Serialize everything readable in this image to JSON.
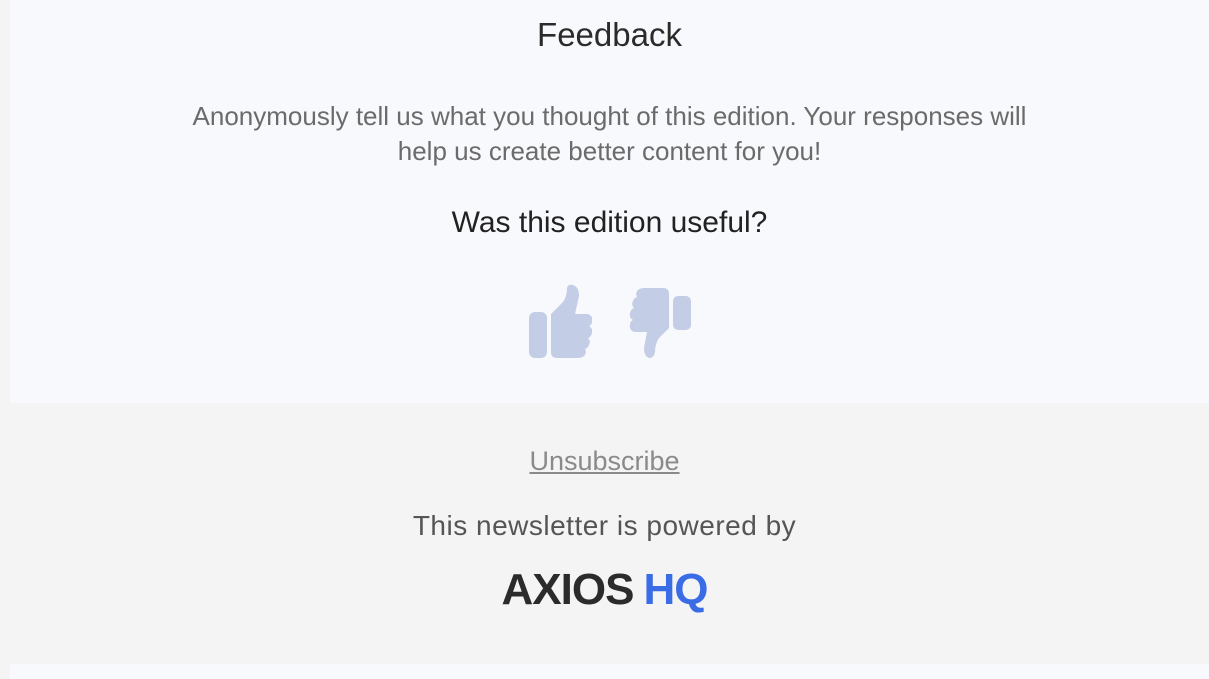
{
  "feedback": {
    "title": "Feedback",
    "description_line1": "Anonymously tell us what you thought of this edition. Your responses will",
    "description_line2": "help us create better content for you!",
    "question": "Was this edition useful?",
    "thumbs_up_icon": "thumbs-up-icon",
    "thumbs_down_icon": "thumbs-down-icon",
    "icon_color": "#c3cde6"
  },
  "footer": {
    "unsubscribe_label": "Unsubscribe",
    "powered_by_text": "This newsletter is powered by",
    "logo_part1": "AXIOS",
    "logo_part2": "HQ",
    "logo_accent_color": "#3a6ce6"
  }
}
